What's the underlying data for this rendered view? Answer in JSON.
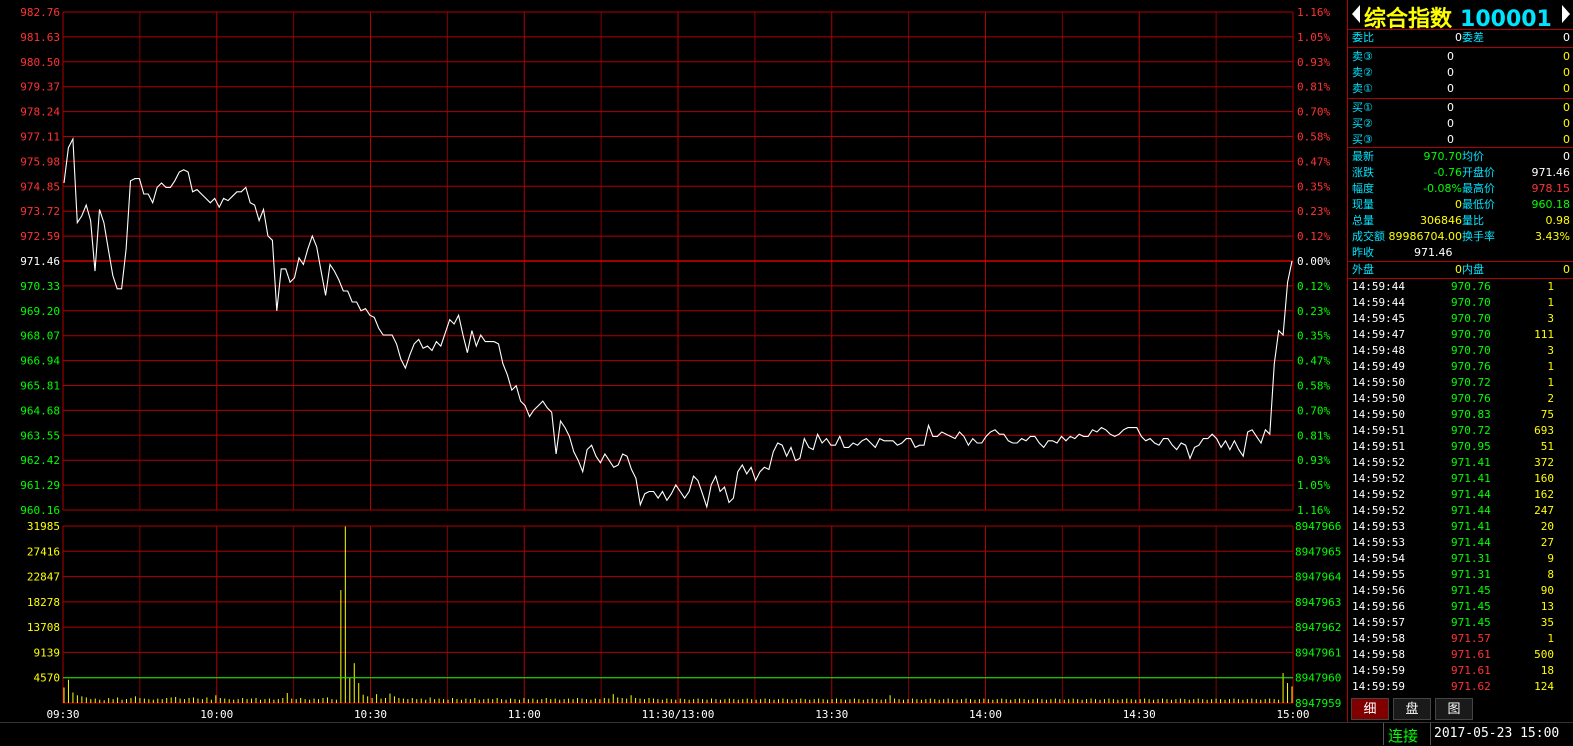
{
  "chart_data": {
    "type": "line",
    "price": {
      "y_ticks_left": [
        "982.76",
        "981.63",
        "980.50",
        "979.37",
        "978.24",
        "977.11",
        "975.98",
        "974.85",
        "973.72",
        "972.59",
        "971.46",
        "970.33",
        "969.20",
        "968.07",
        "966.94",
        "965.81",
        "964.68",
        "963.55",
        "962.42",
        "961.29",
        "960.16"
      ],
      "y_ticks_right": [
        "1.16%",
        "1.05%",
        "0.93%",
        "0.81%",
        "0.70%",
        "0.58%",
        "0.47%",
        "0.35%",
        "0.23%",
        "0.12%",
        "0.00%",
        "0.12%",
        "0.23%",
        "0.35%",
        "0.47%",
        "0.58%",
        "0.70%",
        "0.81%",
        "0.93%",
        "1.05%",
        "1.16%"
      ],
      "ylim": [
        960.16,
        982.76
      ],
      "prev_close": 971.46,
      "values": [
        975.0,
        976.6,
        977.0,
        973.2,
        973.5,
        974.0,
        973.3,
        971.0,
        973.8,
        973.2,
        972.0,
        970.8,
        970.2,
        970.2,
        972.0,
        975.1,
        975.2,
        975.2,
        974.5,
        974.5,
        974.1,
        974.8,
        975.0,
        974.8,
        974.8,
        975.1,
        975.5,
        975.6,
        975.5,
        974.6,
        974.7,
        974.5,
        974.3,
        974.1,
        974.3,
        973.9,
        974.3,
        974.2,
        974.4,
        974.6,
        974.6,
        974.8,
        974.1,
        974.0,
        973.3,
        973.8,
        972.6,
        972.4,
        969.2,
        971.1,
        971.1,
        970.5,
        970.7,
        971.6,
        971.3,
        972.0,
        972.6,
        972.1,
        971.0,
        969.9,
        971.3,
        971.0,
        970.6,
        970.1,
        970.1,
        969.6,
        969.6,
        969.2,
        969.3,
        969.0,
        968.9,
        968.4,
        968.1,
        968.1,
        968.1,
        967.7,
        967.0,
        966.6,
        967.2,
        967.7,
        967.9,
        967.5,
        967.6,
        967.4,
        967.8,
        967.6,
        968.2,
        968.8,
        968.6,
        969.0,
        968.1,
        967.3,
        968.3,
        967.6,
        968.1,
        967.8,
        967.8,
        967.8,
        967.7,
        966.8,
        966.3,
        965.6,
        965.8,
        965.1,
        964.9,
        964.4,
        964.7,
        964.9,
        965.1,
        964.8,
        964.6,
        962.7,
        964.2,
        963.9,
        963.5,
        962.8,
        962.4,
        961.9,
        962.9,
        963.1,
        962.6,
        962.3,
        962.7,
        962.4,
        962.1,
        962.2,
        962.7,
        962.6,
        962.0,
        961.6,
        960.4,
        960.9,
        961.0,
        961.0,
        960.7,
        961.0,
        960.6,
        960.9,
        961.3,
        961.0,
        960.7,
        961.0,
        961.7,
        961.5,
        960.9,
        960.3,
        961.3,
        961.7,
        961.0,
        961.2,
        960.5,
        960.7,
        961.9,
        962.2,
        961.8,
        962.1,
        961.5,
        961.9,
        962.1,
        962.0,
        962.8,
        963.2,
        963.1,
        962.6,
        963.0,
        962.4,
        962.5,
        963.4,
        963.0,
        962.9,
        963.6,
        963.2,
        963.4,
        963.1,
        963.1,
        963.5,
        963.0,
        963.0,
        963.2,
        963.1,
        963.3,
        963.4,
        963.2,
        963.0,
        963.4,
        963.3,
        963.3,
        963.3,
        963.1,
        963.2,
        963.4,
        963.4,
        963.0,
        963.1,
        963.1,
        964.0,
        963.5,
        963.5,
        963.7,
        963.6,
        963.5,
        963.4,
        963.7,
        963.5,
        963.1,
        963.4,
        963.2,
        963.2,
        963.5,
        963.7,
        963.8,
        963.6,
        963.6,
        963.3,
        963.2,
        963.2,
        963.4,
        963.3,
        963.5,
        963.5,
        963.2,
        963.0,
        963.3,
        963.3,
        963.2,
        963.5,
        963.3,
        963.5,
        963.4,
        963.6,
        963.5,
        963.5,
        963.8,
        963.7,
        963.9,
        963.8,
        963.6,
        963.5,
        963.6,
        963.8,
        963.9,
        963.9,
        963.9,
        963.5,
        963.3,
        963.4,
        963.2,
        963.1,
        963.4,
        963.4,
        963.1,
        962.9,
        963.2,
        963.1,
        962.5,
        963.0,
        963.1,
        963.4,
        963.4,
        963.6,
        963.4,
        963.0,
        963.3,
        962.9,
        963.3,
        962.9,
        962.6,
        963.7,
        963.8,
        963.5,
        963.2,
        963.8,
        963.6,
        966.8,
        968.3,
        968.1,
        970.5,
        971.46
      ]
    },
    "volume": {
      "y_ticks_left": [
        "31985",
        "27416",
        "22847",
        "18278",
        "13708",
        "9139",
        "4570"
      ],
      "y_ticks_right": [
        "8947966",
        "8947965",
        "8947964",
        "8947963",
        "8947962",
        "8947961",
        "8947960",
        "8947959"
      ],
      "ylim": [
        0,
        31985
      ],
      "ref_line": 4570,
      "values": [
        2800,
        4200,
        1900,
        1400,
        1200,
        1000,
        700,
        800,
        600,
        500,
        900,
        700,
        1000,
        600,
        700,
        900,
        1200,
        900,
        800,
        700,
        600,
        800,
        700,
        900,
        1000,
        1100,
        800,
        700,
        900,
        1000,
        800,
        700,
        1000,
        600,
        1400,
        900,
        800,
        700,
        600,
        700,
        900,
        700,
        800,
        900,
        600,
        700,
        800,
        600,
        700,
        900,
        1800,
        800,
        700,
        900,
        700,
        600,
        800,
        700,
        900,
        1000,
        700,
        600,
        20400,
        31900,
        4500,
        7200,
        3600,
        1500,
        1200,
        900,
        1600,
        800,
        900,
        1700,
        1200,
        900,
        800,
        700,
        900,
        700,
        800,
        600,
        1000,
        700,
        800,
        700,
        600,
        900,
        700,
        600,
        800,
        700,
        900,
        600,
        700,
        800,
        700,
        900,
        700,
        600,
        800,
        700,
        600,
        900,
        700,
        800,
        600,
        700,
        900,
        700,
        800,
        600,
        700,
        800,
        700,
        900,
        800,
        700,
        600,
        800,
        700,
        900,
        800,
        1600,
        1000,
        900,
        800,
        1400,
        900,
        800,
        700,
        900,
        800,
        700,
        600,
        800,
        700,
        600,
        800,
        700,
        600,
        700,
        800,
        700,
        600,
        800,
        700,
        600,
        700,
        800,
        700,
        600,
        700,
        800,
        700,
        600,
        700,
        800,
        700,
        600,
        700,
        800,
        700,
        600,
        700,
        800,
        700,
        600,
        700,
        800,
        700,
        600,
        700,
        800,
        700,
        600,
        700,
        800,
        700,
        600,
        700,
        800,
        700,
        600,
        700,
        1400,
        800,
        700,
        600,
        700,
        800,
        700,
        600,
        700,
        800,
        700,
        600,
        700,
        800,
        700,
        600,
        700,
        800,
        700,
        600,
        700,
        800,
        700,
        600,
        700,
        800,
        700,
        600,
        700,
        800,
        700,
        600,
        700,
        800,
        700,
        600,
        700,
        800,
        700,
        600,
        700,
        800,
        700,
        600,
        700,
        800,
        700,
        600,
        700,
        800,
        700,
        600,
        700,
        800,
        700,
        600,
        700,
        800,
        700,
        600,
        700,
        800,
        700,
        600,
        700,
        800,
        700,
        600,
        700,
        800,
        700,
        600,
        700,
        800,
        700,
        600,
        700,
        800,
        700,
        600,
        700,
        800,
        700,
        600,
        700,
        800,
        700,
        600,
        5400,
        3600,
        3000
      ]
    },
    "x_ticks": [
      "09:30",
      "10:00",
      "10:30",
      "11:00",
      "11:30/13:00",
      "13:30",
      "14:00",
      "14:30",
      "15:00"
    ],
    "colors": {
      "grid": "#b00000",
      "price_line": "#ffffff",
      "volume_bar": "#ffff00",
      "ref_line": "#00ff00",
      "up": "#ff3333",
      "down": "#00ff00",
      "neutral": "#ffffff"
    }
  },
  "panel": {
    "title_name": "综合指数",
    "title_code": "100001",
    "weibi": {
      "label1": "委比",
      "value1": "0",
      "label2": "委差",
      "value2": "0"
    },
    "sell": [
      {
        "label": "卖③",
        "price": "0",
        "vol": "0"
      },
      {
        "label": "卖②",
        "price": "0",
        "vol": "0"
      },
      {
        "label": "卖①",
        "price": "0",
        "vol": "0"
      }
    ],
    "buy": [
      {
        "label": "买①",
        "price": "0",
        "vol": "0"
      },
      {
        "label": "买②",
        "price": "0",
        "vol": "0"
      },
      {
        "label": "买③",
        "price": "0",
        "vol": "0"
      }
    ],
    "stats": [
      {
        "l1": "最新",
        "v1": "970.70",
        "c1": "val-g",
        "l2": "均价",
        "v2": "0",
        "c2": "val-w"
      },
      {
        "l1": "涨跌",
        "v1": "-0.76",
        "c1": "val-g",
        "l2": "开盘价",
        "v2": "971.46",
        "c2": "val-w"
      },
      {
        "l1": "幅度",
        "v1": "-0.08%",
        "c1": "val-g",
        "l2": "最高价",
        "v2": "978.15",
        "c2": "val-r"
      },
      {
        "l1": "现量",
        "v1": "0",
        "c1": "val-y",
        "l2": "最低价",
        "v2": "960.18",
        "c2": "val-g"
      },
      {
        "l1": "总量",
        "v1": "306846",
        "c1": "val-y",
        "l2": "量比",
        "v2": "0.98",
        "c2": "val-y"
      },
      {
        "l1": "成交额",
        "v1": "89986704.00",
        "c1": "val-y",
        "l2": "换手率",
        "v2": "3.43%",
        "c2": "val-y"
      },
      {
        "l1": "昨收",
        "v1": "971.46",
        "c1": "val-w",
        "l2": "",
        "v2": "",
        "c2": "val-w"
      }
    ],
    "waipan": {
      "label1": "外盘",
      "value1": "0",
      "label2": "内盘",
      "value2": "0"
    },
    "ticks": [
      {
        "time": "14:59:44",
        "price": "970.76",
        "vol": "1",
        "color": "val-g"
      },
      {
        "time": "14:59:44",
        "price": "970.70",
        "vol": "1",
        "color": "val-g"
      },
      {
        "time": "14:59:45",
        "price": "970.70",
        "vol": "3",
        "color": "val-g"
      },
      {
        "time": "14:59:47",
        "price": "970.70",
        "vol": "111",
        "color": "val-g"
      },
      {
        "time": "14:59:48",
        "price": "970.70",
        "vol": "3",
        "color": "val-g"
      },
      {
        "time": "14:59:49",
        "price": "970.76",
        "vol": "1",
        "color": "val-g"
      },
      {
        "time": "14:59:50",
        "price": "970.72",
        "vol": "1",
        "color": "val-g"
      },
      {
        "time": "14:59:50",
        "price": "970.76",
        "vol": "2",
        "color": "val-g"
      },
      {
        "time": "14:59:50",
        "price": "970.83",
        "vol": "75",
        "color": "val-g"
      },
      {
        "time": "14:59:51",
        "price": "970.72",
        "vol": "693",
        "color": "val-g"
      },
      {
        "time": "14:59:51",
        "price": "970.95",
        "vol": "51",
        "color": "val-g"
      },
      {
        "time": "14:59:52",
        "price": "971.41",
        "vol": "372",
        "color": "val-g"
      },
      {
        "time": "14:59:52",
        "price": "971.41",
        "vol": "160",
        "color": "val-g"
      },
      {
        "time": "14:59:52",
        "price": "971.44",
        "vol": "162",
        "color": "val-g"
      },
      {
        "time": "14:59:52",
        "price": "971.44",
        "vol": "247",
        "color": "val-g"
      },
      {
        "time": "14:59:53",
        "price": "971.41",
        "vol": "20",
        "color": "val-g"
      },
      {
        "time": "14:59:53",
        "price": "971.44",
        "vol": "27",
        "color": "val-g"
      },
      {
        "time": "14:59:54",
        "price": "971.31",
        "vol": "9",
        "color": "val-g"
      },
      {
        "time": "14:59:55",
        "price": "971.31",
        "vol": "8",
        "color": "val-g"
      },
      {
        "time": "14:59:56",
        "price": "971.45",
        "vol": "90",
        "color": "val-g"
      },
      {
        "time": "14:59:56",
        "price": "971.45",
        "vol": "13",
        "color": "val-g"
      },
      {
        "time": "14:59:57",
        "price": "971.45",
        "vol": "35",
        "color": "val-g"
      },
      {
        "time": "14:59:58",
        "price": "971.57",
        "vol": "1",
        "color": "val-r"
      },
      {
        "time": "14:59:58",
        "price": "971.61",
        "vol": "500",
        "color": "val-r"
      },
      {
        "time": "14:59:59",
        "price": "971.61",
        "vol": "18",
        "color": "val-r"
      },
      {
        "time": "14:59:59",
        "price": "971.62",
        "vol": "124",
        "color": "val-r"
      }
    ],
    "tabs": [
      "细",
      "盘",
      "图"
    ]
  },
  "status": {
    "connection": "连接",
    "datetime": "2017-05-23 15:00"
  }
}
